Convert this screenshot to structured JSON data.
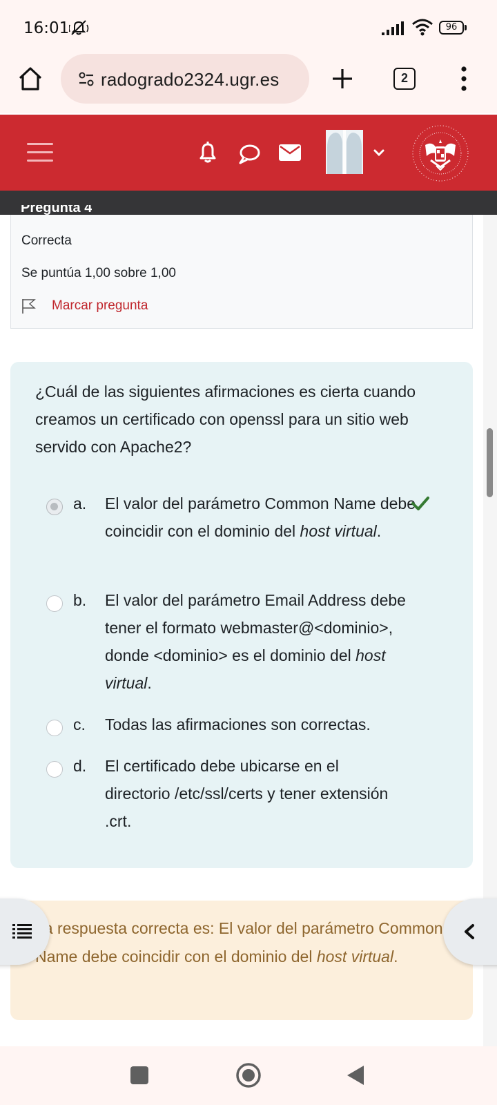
{
  "status_bar": {
    "time": "16:01",
    "battery": "96",
    "icons": [
      "mute-icon",
      "signal-icon",
      "wifi-icon",
      "battery-icon"
    ]
  },
  "browser": {
    "url": "radogrado2324.ugr.es",
    "tab_count": "2",
    "icons": [
      "home-icon",
      "site-settings-icon",
      "new-tab-icon",
      "tab-switcher-icon",
      "more-menu-icon"
    ]
  },
  "header": {
    "brand_color": "#cc2a30",
    "icons": [
      "menu-icon",
      "bell-icon",
      "chat-icon",
      "mail-icon",
      "avatar",
      "chevron-down-icon",
      "ugr-logo"
    ]
  },
  "question_info": {
    "title_cut": "Pregunta 4",
    "state": "Correcta",
    "grade": "Se puntúa 1,00 sobre 1,00",
    "flag_label": "Marcar pregunta"
  },
  "question": {
    "text": "¿Cuál de las siguientes afirmaciones es cierta cuando creamos un certificado con openssl para un sitio web servido con Apache2?",
    "answers": [
      {
        "letter": "a.",
        "text_before": "El valor del parámetro Common Name debe coincidir con el dominio del ",
        "emph": "host virtual",
        "text_after": ".",
        "selected": true,
        "correct": true
      },
      {
        "letter": "b.",
        "text_before": "El valor del parámetro Email Address debe tener el formato webmaster@<dominio>, donde <dominio> es el dominio del ",
        "emph": "host virtual",
        "text_after": ".",
        "selected": false,
        "correct": false
      },
      {
        "letter": "c.",
        "text_before": "Todas las afirmaciones son correctas.",
        "emph": "",
        "text_after": "",
        "selected": false,
        "correct": false
      },
      {
        "letter": "d.",
        "text_before": "El certificado debe ubicarse en el directorio /etc/ssl/certs y tener extensión .crt.",
        "emph": "",
        "text_after": "",
        "selected": false,
        "correct": false
      }
    ],
    "colors": {
      "question_bg": "#e7f3f5",
      "correct_check": "#357a32"
    }
  },
  "feedback": {
    "text_before": "La respuesta correcta es: El valor del parámetro Common Name debe coincidir con el dominio del ",
    "emph": "host virtual",
    "text_after": ".",
    "colors": {
      "bg": "#fcefdc",
      "text": "#8e662e"
    }
  },
  "floating": {
    "left_icon": "list-icon",
    "right_icon": "chevron-left-icon"
  },
  "nav_bar": {
    "icons": [
      "recents-icon",
      "home-circle-icon",
      "back-icon"
    ]
  }
}
